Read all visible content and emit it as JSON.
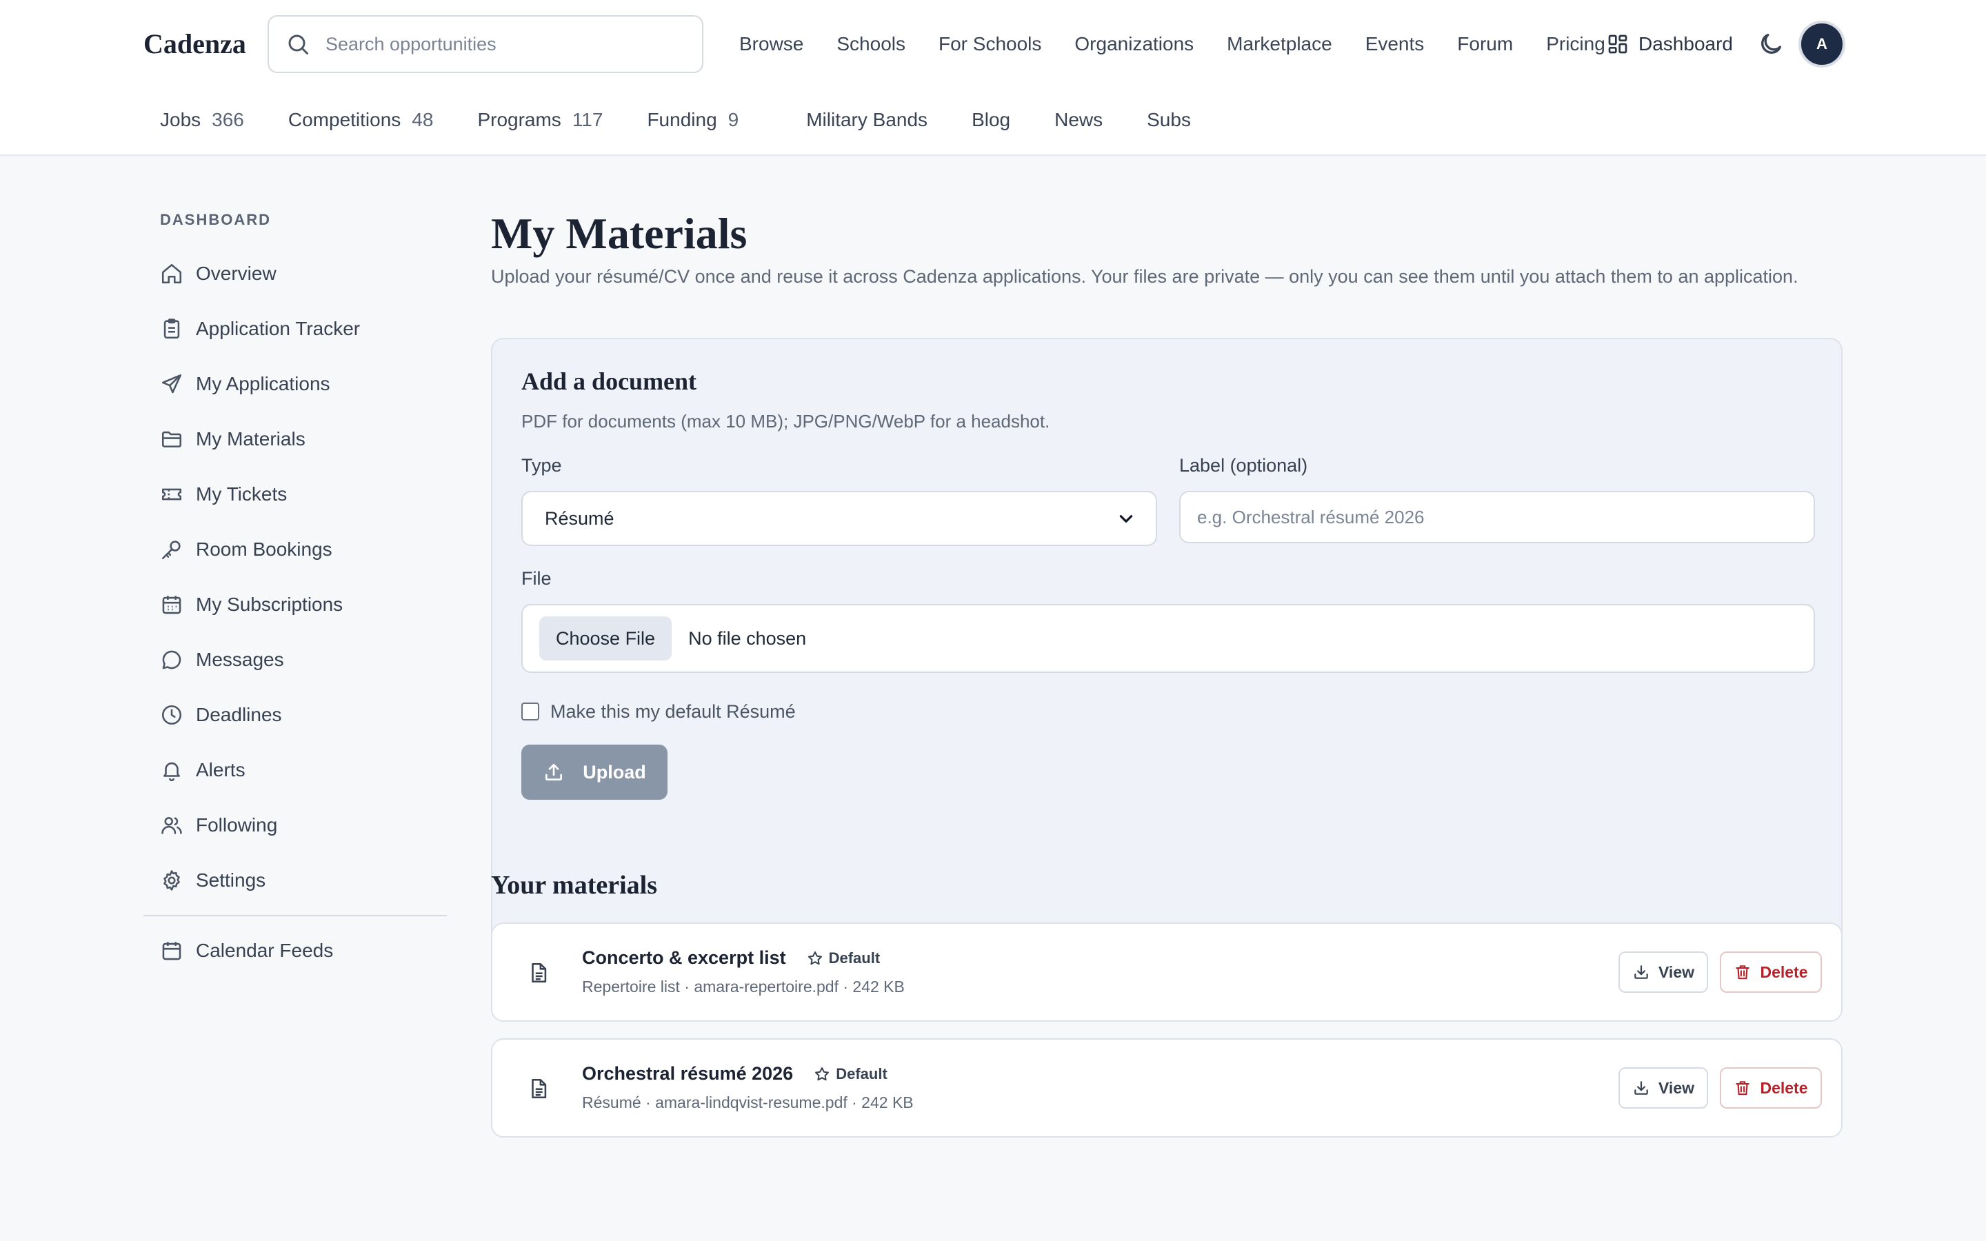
{
  "header": {
    "logo": "Cadenza",
    "search_placeholder": "Search opportunities",
    "nav": [
      "Browse",
      "Schools",
      "For Schools",
      "Organizations",
      "Marketplace",
      "Events",
      "Forum",
      "Pricing"
    ],
    "dashboard_label": "Dashboard",
    "avatar_initial": "A"
  },
  "subnav": [
    {
      "label": "Jobs",
      "count": "366"
    },
    {
      "label": "Competitions",
      "count": "48"
    },
    {
      "label": "Programs",
      "count": "117"
    },
    {
      "label": "Funding",
      "count": "9"
    },
    {
      "label": "Military Bands"
    },
    {
      "label": "Blog"
    },
    {
      "label": "News"
    },
    {
      "label": "Subs"
    }
  ],
  "sidebar": {
    "title": "DASHBOARD",
    "items": [
      {
        "label": "Overview",
        "icon": "home-icon"
      },
      {
        "label": "Application Tracker",
        "icon": "clipboard-icon"
      },
      {
        "label": "My Applications",
        "icon": "send-icon"
      },
      {
        "label": "My Materials",
        "icon": "folder-icon"
      },
      {
        "label": "My Tickets",
        "icon": "ticket-icon"
      },
      {
        "label": "Room Bookings",
        "icon": "key-icon"
      },
      {
        "label": "My Subscriptions",
        "icon": "calendar-grid-icon"
      },
      {
        "label": "Messages",
        "icon": "chat-icon"
      },
      {
        "label": "Deadlines",
        "icon": "clock-icon"
      },
      {
        "label": "Alerts",
        "icon": "bell-icon"
      },
      {
        "label": "Following",
        "icon": "users-icon"
      },
      {
        "label": "Settings",
        "icon": "gear-icon"
      }
    ],
    "footer_item": {
      "label": "Calendar Feeds",
      "icon": "calendar-icon"
    }
  },
  "main": {
    "title": "My Materials",
    "subtitle": "Upload your résumé/CV once and reuse it across Cadenza applications. Your files are private — only you can see them until you attach them to an application.",
    "form": {
      "title": "Add a document",
      "subtitle": "PDF for documents (max 10 MB); JPG/PNG/WebP for a headshot.",
      "type_label": "Type",
      "type_value": "Résumé",
      "label_label": "Label (optional)",
      "label_placeholder": "e.g. Orchestral résumé 2026",
      "file_label": "File",
      "choose_file": "Choose File",
      "no_file": "No file chosen",
      "default_checkbox": "Make this my default Résumé",
      "upload": "Upload"
    },
    "materials_title": "Your materials",
    "materials": [
      {
        "name": "Concerto & excerpt list",
        "badge": "Default",
        "meta": "Repertoire list · amara-repertoire.pdf · 242 KB",
        "view": "View",
        "delete": "Delete"
      },
      {
        "name": "Orchestral résumé 2026",
        "badge": "Default",
        "meta": "Résumé · amara-lindqvist-resume.pdf · 242 KB",
        "view": "View",
        "delete": "Delete"
      }
    ]
  },
  "colors": {
    "accent": "#1e2b45",
    "upload_button": "#8896a8",
    "delete": "#b4232a"
  }
}
